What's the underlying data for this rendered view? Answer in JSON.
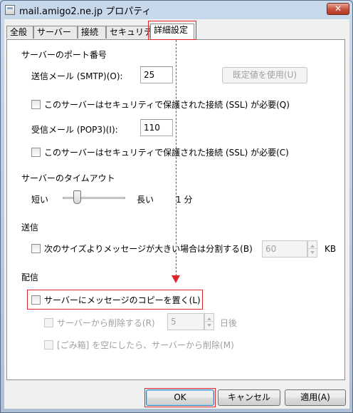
{
  "window": {
    "title": "mail.amigo2.ne.jp プロパティ",
    "close_label": "✕"
  },
  "tabs": [
    {
      "label": "全般"
    },
    {
      "label": "サーバー"
    },
    {
      "label": "接続"
    },
    {
      "label": "セキュリティ"
    },
    {
      "label": "詳細設定",
      "selected": true
    }
  ],
  "server_ports": {
    "heading": "サーバーのポート番号",
    "smtp_label": "送信メール (SMTP)(O):",
    "smtp_value": "25",
    "default_button": "既定値を使用(U)",
    "smtp_ssl_label": "このサーバーはセキュリティで保護された接続 (SSL) が必要(Q)",
    "smtp_ssl_checked": false,
    "pop3_label": "受信メール (POP3)(I):",
    "pop3_value": "110",
    "pop3_ssl_label": "このサーバーはセキュリティで保護された接続 (SSL) が必要(C)",
    "pop3_ssl_checked": false
  },
  "timeout": {
    "heading": "サーバーのタイムアウト",
    "short_label": "短い",
    "long_label": "長い",
    "value_label": "1 分",
    "slider_level": 0.2
  },
  "sending": {
    "heading": "送信",
    "split_label": "次のサイズよりメッセージが大きい場合は分割する(B)",
    "split_checked": false,
    "split_value": "60",
    "split_unit": "KB"
  },
  "delivery": {
    "heading": "配信",
    "leave_copy_label": "サーバーにメッセージのコピーを置く(L)",
    "leave_copy_checked": false,
    "remove_after_label": "サーバーから削除する(R)",
    "remove_after_value": "5",
    "remove_after_unit": "日後",
    "remove_when_trash_label": "[ごみ箱] を空にしたら、サーバーから削除(M)"
  },
  "buttons": {
    "ok": "OK",
    "cancel": "キャンセル",
    "apply": "適用(A)"
  },
  "colors": {
    "annotation": "#e0262a",
    "selection_border": "#3c7fb1"
  }
}
